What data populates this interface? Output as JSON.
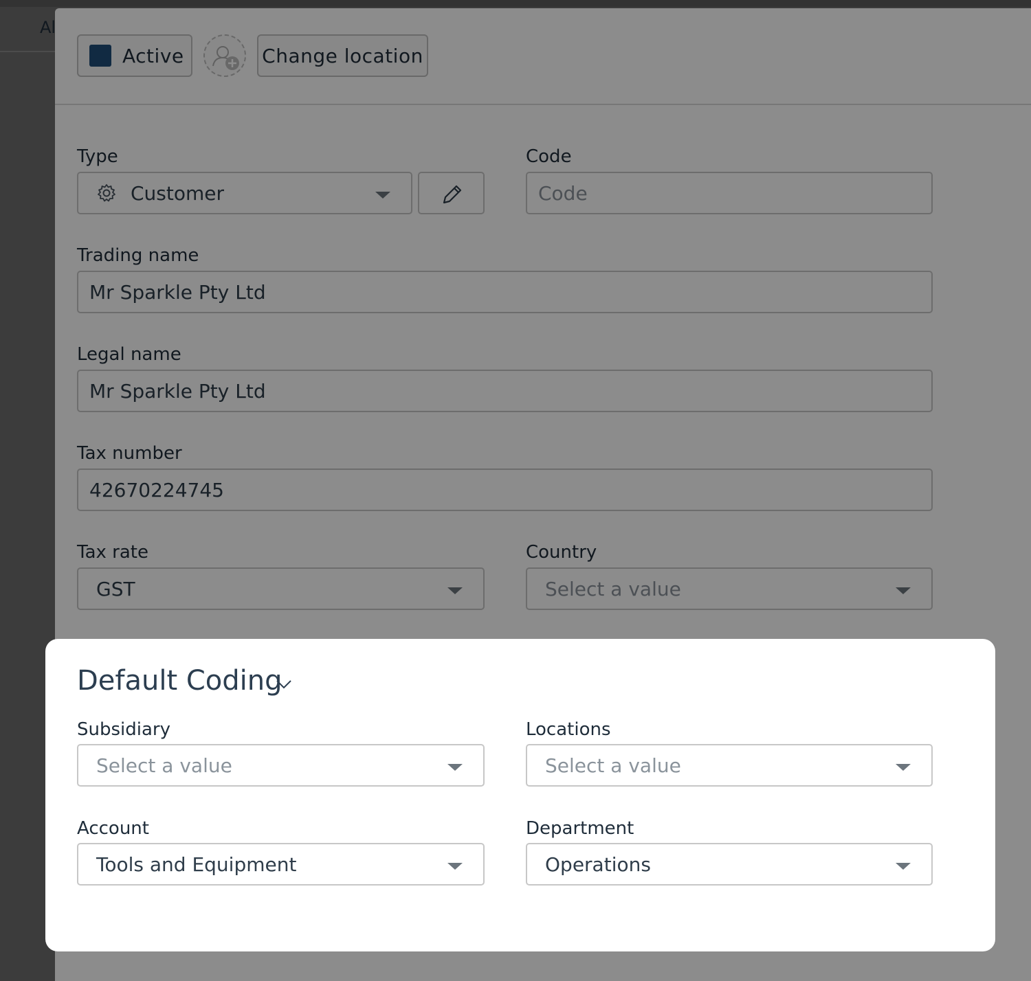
{
  "background": {
    "tab_label": "Al"
  },
  "header": {
    "status_label": "Active",
    "status_color": "#1f4e79",
    "add_user_icon": "user-plus-icon",
    "change_location_label": "Change location"
  },
  "form": {
    "type": {
      "label": "Type",
      "value": "Customer",
      "icon": "gear-icon"
    },
    "code": {
      "label": "Code",
      "placeholder": "Code"
    },
    "trading_name": {
      "label": "Trading name",
      "value": "Mr Sparkle Pty Ltd"
    },
    "legal_name": {
      "label": "Legal name",
      "value": "Mr Sparkle Pty Ltd"
    },
    "tax_number": {
      "label": "Tax number",
      "value": "42670224745"
    },
    "tax_rate": {
      "label": "Tax rate",
      "value": "GST"
    },
    "country": {
      "label": "Country",
      "placeholder": "Select a value"
    }
  },
  "default_coding": {
    "title": "Default Coding",
    "subsidiary": {
      "label": "Subsidiary",
      "placeholder": "Select a value"
    },
    "locations": {
      "label": "Locations",
      "placeholder": "Select a value"
    },
    "account": {
      "label": "Account",
      "value": "Tools and Equipment"
    },
    "department": {
      "label": "Department",
      "value": "Operations"
    }
  }
}
